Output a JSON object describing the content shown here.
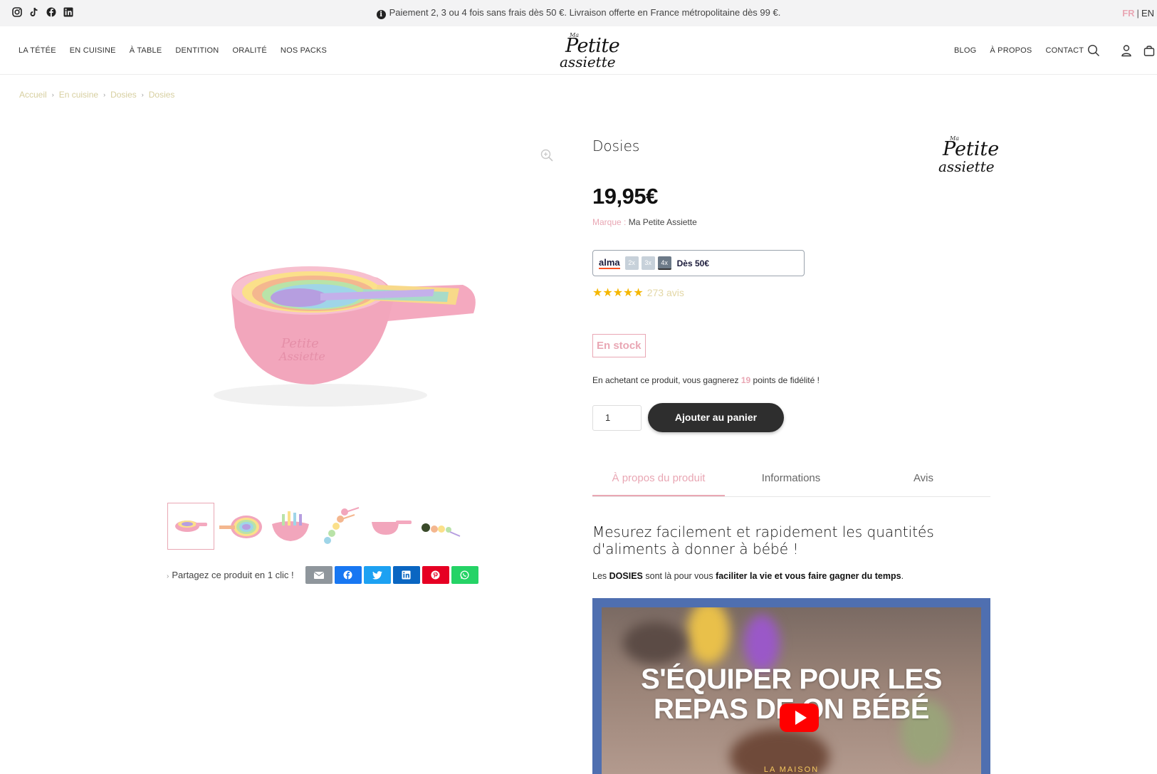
{
  "topbar": {
    "social": [
      "instagram-icon",
      "tiktok-icon",
      "facebook-icon",
      "linkedin-icon"
    ],
    "promo": "Paiement 2, 3 ou 4 fois sans frais dès 50 €. Livraison offerte en France métropolitaine dès 99 €.",
    "lang": {
      "fr": "FR",
      "sep": "|",
      "en": "EN"
    }
  },
  "header": {
    "nav_left": [
      "LA TÉTÉE",
      "EN CUISINE",
      "À TABLE",
      "DENTITION",
      "ORALITÉ",
      "NOS PACKS"
    ],
    "nav_right": [
      "BLOG",
      "À PROPOS",
      "CONTACT"
    ],
    "logo": {
      "ma": "Ma",
      "petite": "Petite",
      "assiette": "assiette"
    },
    "icons": [
      "search-icon",
      "user-icon",
      "cart-icon"
    ]
  },
  "breadcrumb": [
    "Accueil",
    "En cuisine",
    "Dosies",
    "Dosies"
  ],
  "product": {
    "title": "Dosies",
    "price": "19,95€",
    "brand_label": "Marque :",
    "brand_value": "Ma Petite Assiette",
    "alma": {
      "logo": "alma",
      "options": [
        "2x",
        "3x",
        "4x"
      ],
      "selected": "4x",
      "from": "Dès 50€"
    },
    "rating": {
      "stars": "★★★★★",
      "count": "273 avis"
    },
    "stock": "En stock",
    "fidelity": {
      "before": "En achetant ce produit, vous gagnerez",
      "points": "19",
      "after": "points de fidélité !"
    },
    "quantity": "1",
    "add_to_cart": "Ajouter au panier"
  },
  "share": {
    "label": "Partagez ce produit en 1 clic !",
    "buttons": [
      {
        "icon": "email-icon",
        "color": "#8f969c"
      },
      {
        "icon": "facebook-icon",
        "color": "#1877f2"
      },
      {
        "icon": "twitter-icon",
        "color": "#1da1f2"
      },
      {
        "icon": "linkedin-icon",
        "color": "#0a66c2"
      },
      {
        "icon": "pinterest-icon",
        "color": "#e60023"
      },
      {
        "icon": "whatsapp-icon",
        "color": "#25d366"
      }
    ]
  },
  "tabs": [
    "À propos du produit",
    "Informations",
    "Avis"
  ],
  "description": {
    "title": "Mesurez facilement et rapidement les quantités d'aliments à donner à bébé !",
    "text_1": "Les",
    "text_bold_1": "DOSIES",
    "text_2": "sont là pour vous",
    "text_bold_2": "faciliter la vie et vous faire gagner du temps",
    "text_3": "."
  },
  "video": {
    "title_line_1": "S'ÉQUIPER POUR LES",
    "title_line_2": "REPAS DE  ON BÉBÉ",
    "subtitle": "LA MAISON"
  },
  "colors": {
    "accent_pink": "#e9a7b4",
    "button_dark": "#2e2e2e",
    "star": "#f5b700",
    "video_frame": "#4f6fb0"
  }
}
